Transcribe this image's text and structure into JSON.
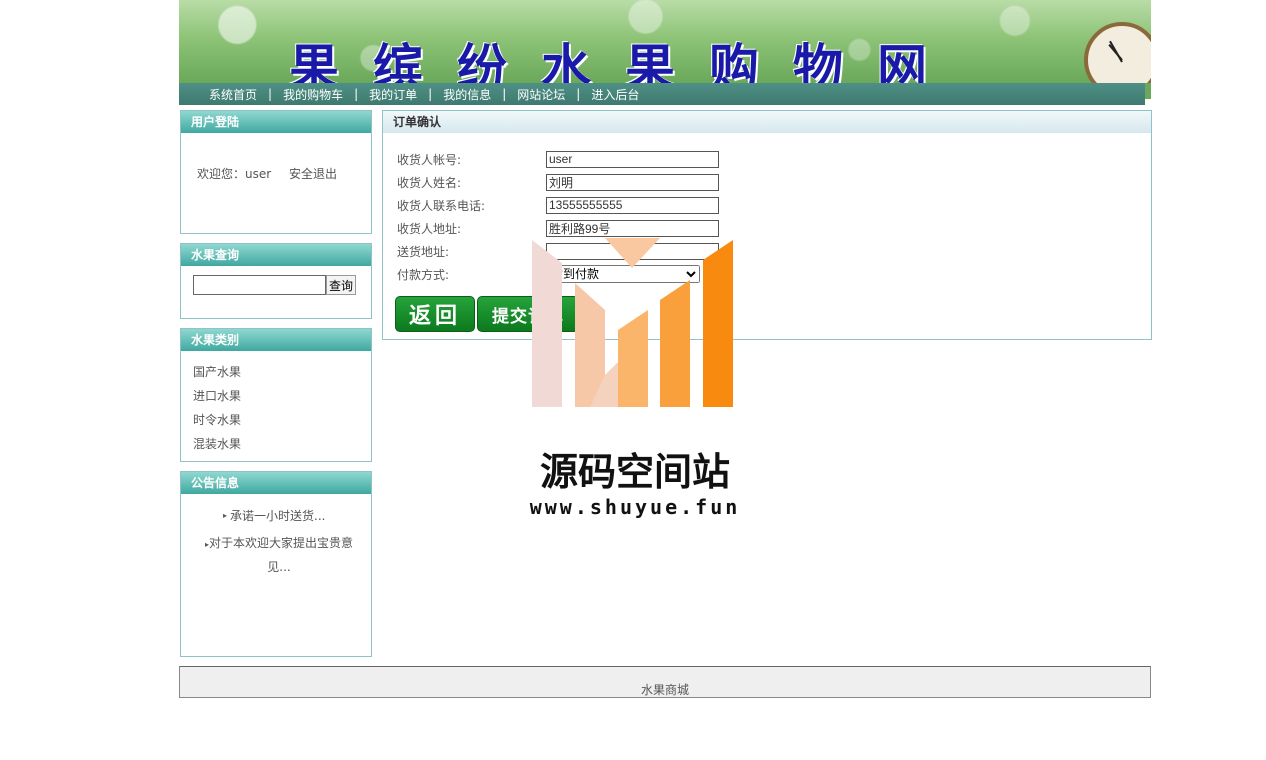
{
  "banner": {
    "title": "果缤纷水果购物网"
  },
  "nav": {
    "items": [
      "系统首页",
      "我的购物车",
      "我的订单",
      "我的信息",
      "网站论坛",
      "进入后台"
    ]
  },
  "login": {
    "title": "用户登陆",
    "welcome": "欢迎您：user",
    "logout": "安全退出"
  },
  "search": {
    "title": "水果查询",
    "button": "查询",
    "value": ""
  },
  "categories": {
    "title": "水果类别",
    "items": [
      "国产水果",
      "进口水果",
      "时令水果",
      "混装水果"
    ]
  },
  "notices": {
    "title": "公告信息",
    "items": [
      "承诺一小时送货...",
      "对于本欢迎大家提出宝贵意见..."
    ]
  },
  "order": {
    "title": "订单确认",
    "fields": [
      {
        "label": "收货人帐号:",
        "value": "user"
      },
      {
        "label": "收货人姓名:",
        "value": "刘明"
      },
      {
        "label": "收货人联系电话:",
        "value": "13555555555"
      },
      {
        "label": "收货人地址:",
        "value": "胜利路99号"
      },
      {
        "label": "送货地址:",
        "value": ""
      }
    ],
    "payment": {
      "label": "付款方式:",
      "selected": "货到付款"
    },
    "back_button": "返回",
    "submit_button": "提交订单"
  },
  "footer": {
    "text": "水果商城"
  },
  "watermark": {
    "name": "源码空间站",
    "url": "www.shuyue.fun"
  }
}
